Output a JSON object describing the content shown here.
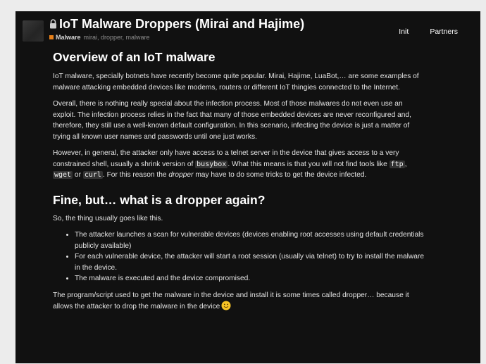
{
  "header": {
    "title": "IoT Malware Droppers (Mirai and Hajime)",
    "category": "Malware",
    "tags": "mirai, dropper, malware",
    "nav": [
      "Init",
      "Partners"
    ]
  },
  "colors": {
    "background": "#111111",
    "category_accent": "#e8811a",
    "text": "#e4e4e4"
  },
  "icons": [
    "lock-icon",
    "smile-emoji-icon"
  ],
  "sections": [
    {
      "heading": "Overview of an IoT malware",
      "p1": "IoT malware, specially botnets have recently become quite popular. Mirai, Hajime, LuaBot,… are some examples of malware attacking embedded devices like modems, routers or different IoT thingies connected to the Internet.",
      "p2": "Overall, there is nothing really special about the infection process. Most of those malwares do not even use an exploit. The infection process relies in the fact that many of those embedded devices are never reconfigured and, therefore, they still use a well-known default configuration. In this scenario, infecting the device is just a matter of trying all known user names and passwords until one just works.",
      "p3": {
        "a": "However, in general, the attacker only have access to a telnet server in the device that gives access to a very constrained shell, usually a shrink version of ",
        "code1": "busybox",
        "b": ". What this means is that you will not find tools like ",
        "code2": "ftp",
        "c": ", ",
        "code3": "wget",
        "d": " or ",
        "code4": "curl",
        "e": ". For this reason the ",
        "em": "dropper",
        "f": " may have to do some tricks to get the device infected."
      }
    },
    {
      "heading": "Fine, but… what is a dropper again?",
      "intro": "So, the thing usually goes like this.",
      "bullets": [
        "The attacker launches a scan for vulnerable devices (devices enabling root accesses using default credentials publicly available)",
        "For each vulnerable device, the attacker will start a root session (usually via telnet) to try to install the malware in the device.",
        "The malware is executed and the device compromised."
      ],
      "outro": "The program/script used to get the malware in the device and install it is some times called dropper… because it allows the attacker to drop the malware in the device"
    }
  ]
}
